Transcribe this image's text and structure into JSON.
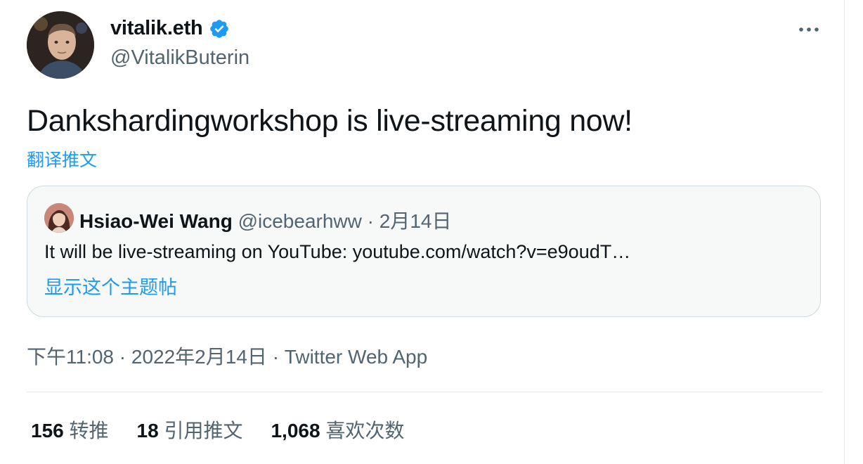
{
  "author": {
    "display_name": "vitalik.eth",
    "handle": "@VitalikButerin",
    "verified": true
  },
  "tweet": {
    "text": "Dankshardingworkshop is live-streaming now!",
    "translate_label": "翻译推文"
  },
  "quoted_tweet": {
    "display_name": "Hsiao-Wei Wang",
    "handle": "@icebearhww",
    "separator": "·",
    "date": "2月14日",
    "text": "It will be live-streaming on YouTube: youtube.com/watch?v=e9oudT…",
    "show_thread_label": "显示这个主题帖"
  },
  "meta": {
    "time": "下午11:08",
    "separator": "·",
    "date": "2022年2月14日",
    "separator2": "·",
    "source": "Twitter Web App"
  },
  "stats": {
    "retweets_count": "156",
    "retweets_label": "转推",
    "quotes_count": "18",
    "quotes_label": "引用推文",
    "likes_count": "1,068",
    "likes_label": "喜欢次数"
  },
  "colors": {
    "accent": "#1d9bf0",
    "secondary_text": "#536471",
    "primary_text": "#0f1419",
    "border": "#cfd9de"
  },
  "icons": {
    "verified": "verified-badge-icon",
    "more": "more-options-icon"
  }
}
